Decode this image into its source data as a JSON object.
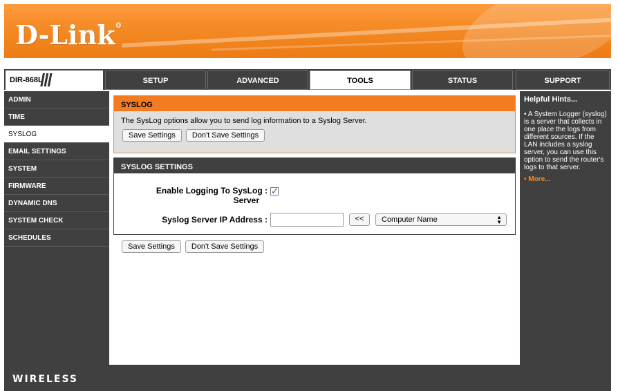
{
  "brand": {
    "logo": "D-Link",
    "registered": "®",
    "model": "DIR-868L",
    "model_slash": "///"
  },
  "nav": {
    "tabs": [
      {
        "label": "SETUP"
      },
      {
        "label": "ADVANCED"
      },
      {
        "label": "TOOLS",
        "active": true
      },
      {
        "label": "STATUS"
      },
      {
        "label": "SUPPORT"
      }
    ]
  },
  "sidebar": {
    "items": [
      {
        "label": "ADMIN"
      },
      {
        "label": "TIME"
      },
      {
        "label": "SYSLOG",
        "active": true
      },
      {
        "label": "EMAIL SETTINGS"
      },
      {
        "label": "SYSTEM"
      },
      {
        "label": "FIRMWARE"
      },
      {
        "label": "DYNAMIC DNS"
      },
      {
        "label": "SYSTEM CHECK"
      },
      {
        "label": "SCHEDULES"
      }
    ]
  },
  "syslog": {
    "title": "SYSLOG",
    "description": "The SysLog options allow you to send log information to a Syslog Server.",
    "save_label": "Save Settings",
    "dont_save_label": "Don't Save Settings"
  },
  "settings": {
    "title": "SYSLOG SETTINGS",
    "enable_label_line1": "Enable Logging To SysLog :",
    "enable_label_line2": "Server",
    "enable_checked": true,
    "ip_label": "Syslog Server IP Address :",
    "ip_value": "",
    "copy_button": "<<",
    "computer_select": "Computer Name"
  },
  "bottom": {
    "save_label": "Save Settings",
    "dont_save_label": "Don't Save Settings"
  },
  "hints": {
    "title": "Helpful Hints...",
    "text": "• A System Logger (syslog) is a server that collects in one place the logs from different sources. If the LAN includes a syslog server, you can use this option to send the router's logs to that server.",
    "more": "• More..."
  },
  "footer": {
    "label": "WIRELESS"
  },
  "colors": {
    "accent": "#f47b20",
    "dark": "#404040",
    "panel": "#dfdfdf"
  }
}
